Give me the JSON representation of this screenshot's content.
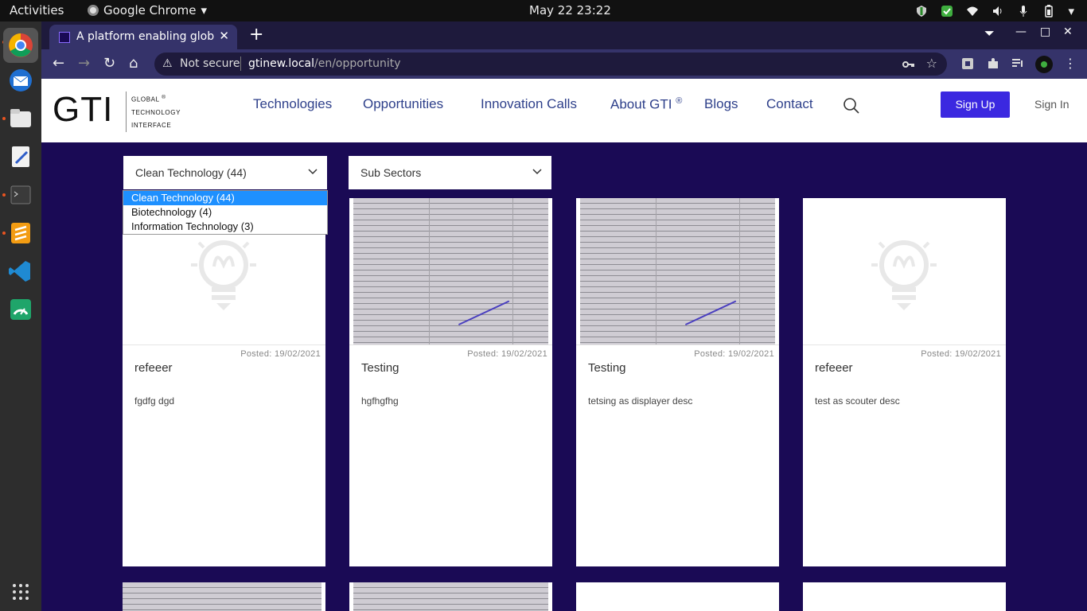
{
  "system": {
    "activities": "Activities",
    "app_name": "Google Chrome",
    "clock": "May 22  23:22"
  },
  "browser": {
    "tab_title": "A platform enabling glob",
    "tab_close": "✕",
    "new_tab": "+",
    "security_text": "Not secure",
    "url_host": "gtinew.local",
    "url_path": "/en/opportunity",
    "back": "←",
    "forward": "→",
    "reload": "↻",
    "home": "⌂",
    "minimize": "—",
    "maximize": "□",
    "close": "✕"
  },
  "site": {
    "logo": "GTI",
    "logo_sub_1": "GLOBAL",
    "logo_reg": "®",
    "logo_sub_2": "TECHNOLOGY",
    "logo_sub_3": "INTERFACE",
    "nav": [
      {
        "label": "Technologies"
      },
      {
        "label": "Opportunities"
      },
      {
        "label": "Innovation Calls"
      },
      {
        "label": "About GTI",
        "sup": "®"
      },
      {
        "label": "Blogs"
      },
      {
        "label": "Contact"
      }
    ],
    "signup": "Sign Up",
    "signin": "Sign In"
  },
  "filters": {
    "sector_value": "Clean Technology (44)",
    "subsector_value": "Sub Sectors",
    "sector_options": [
      "Clean Technology (44)",
      "Biotechnology (4)",
      "Information Technology (3)"
    ]
  },
  "cards": [
    {
      "posted": "Posted: 19/02/2021",
      "title": "refeeer",
      "desc": "fgdfg dgd",
      "media": "placeholder"
    },
    {
      "posted": "Posted: 19/02/2021",
      "title": "Testing",
      "desc": "hgfhgfhg",
      "media": "photo"
    },
    {
      "posted": "Posted: 19/02/2021",
      "title": "Testing",
      "desc": "tetsing as displayer desc",
      "media": "photo"
    },
    {
      "posted": "Posted: 19/02/2021",
      "title": "refeeer",
      "desc": "test as scouter desc",
      "media": "placeholder"
    }
  ],
  "colors": {
    "page_bg": "#1a0a55",
    "brand_button": "#3b28e0",
    "nav_text": "#2d3f8a",
    "dropdown_selected": "#1e90ff"
  }
}
